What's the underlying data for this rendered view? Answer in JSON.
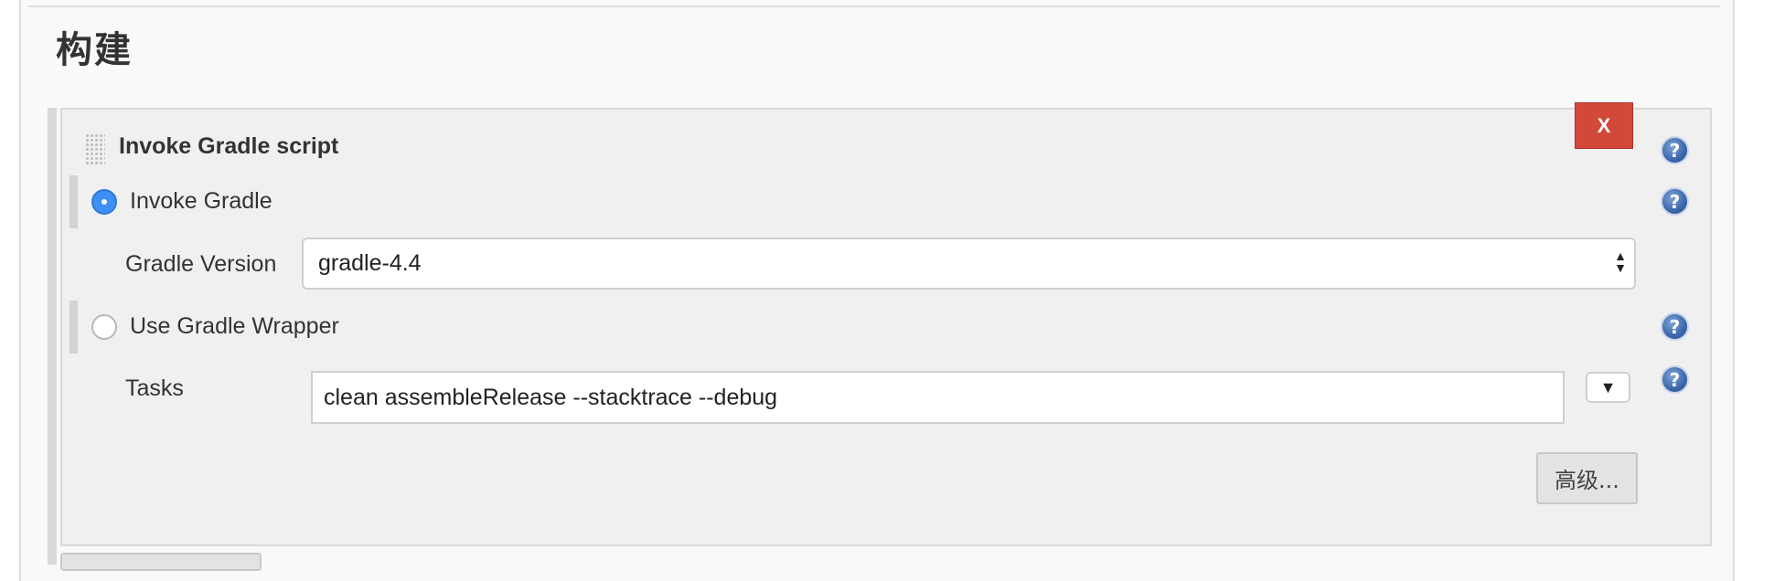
{
  "section": {
    "title": "构建"
  },
  "step": {
    "title": "Invoke Gradle script",
    "delete_label": "X",
    "help_glyph": "?"
  },
  "options": {
    "invoke_gradle": {
      "label": "Invoke Gradle",
      "checked": true
    },
    "gradle_version": {
      "label": "Gradle Version",
      "value": "gradle-4.4"
    },
    "use_wrapper": {
      "label": "Use Gradle Wrapper",
      "checked": false
    },
    "tasks": {
      "label": "Tasks",
      "value": "clean assembleRelease --stacktrace --debug",
      "expand_glyph": "▼"
    }
  },
  "advanced": {
    "label": "高级..."
  },
  "icons": {
    "help": "help-icon",
    "drag": "drag-handle-icon",
    "expand": "expand-down-icon"
  },
  "colors": {
    "delete": "#d24939",
    "radio_checked": "#3d8ff3",
    "help": "#3b67ad"
  }
}
